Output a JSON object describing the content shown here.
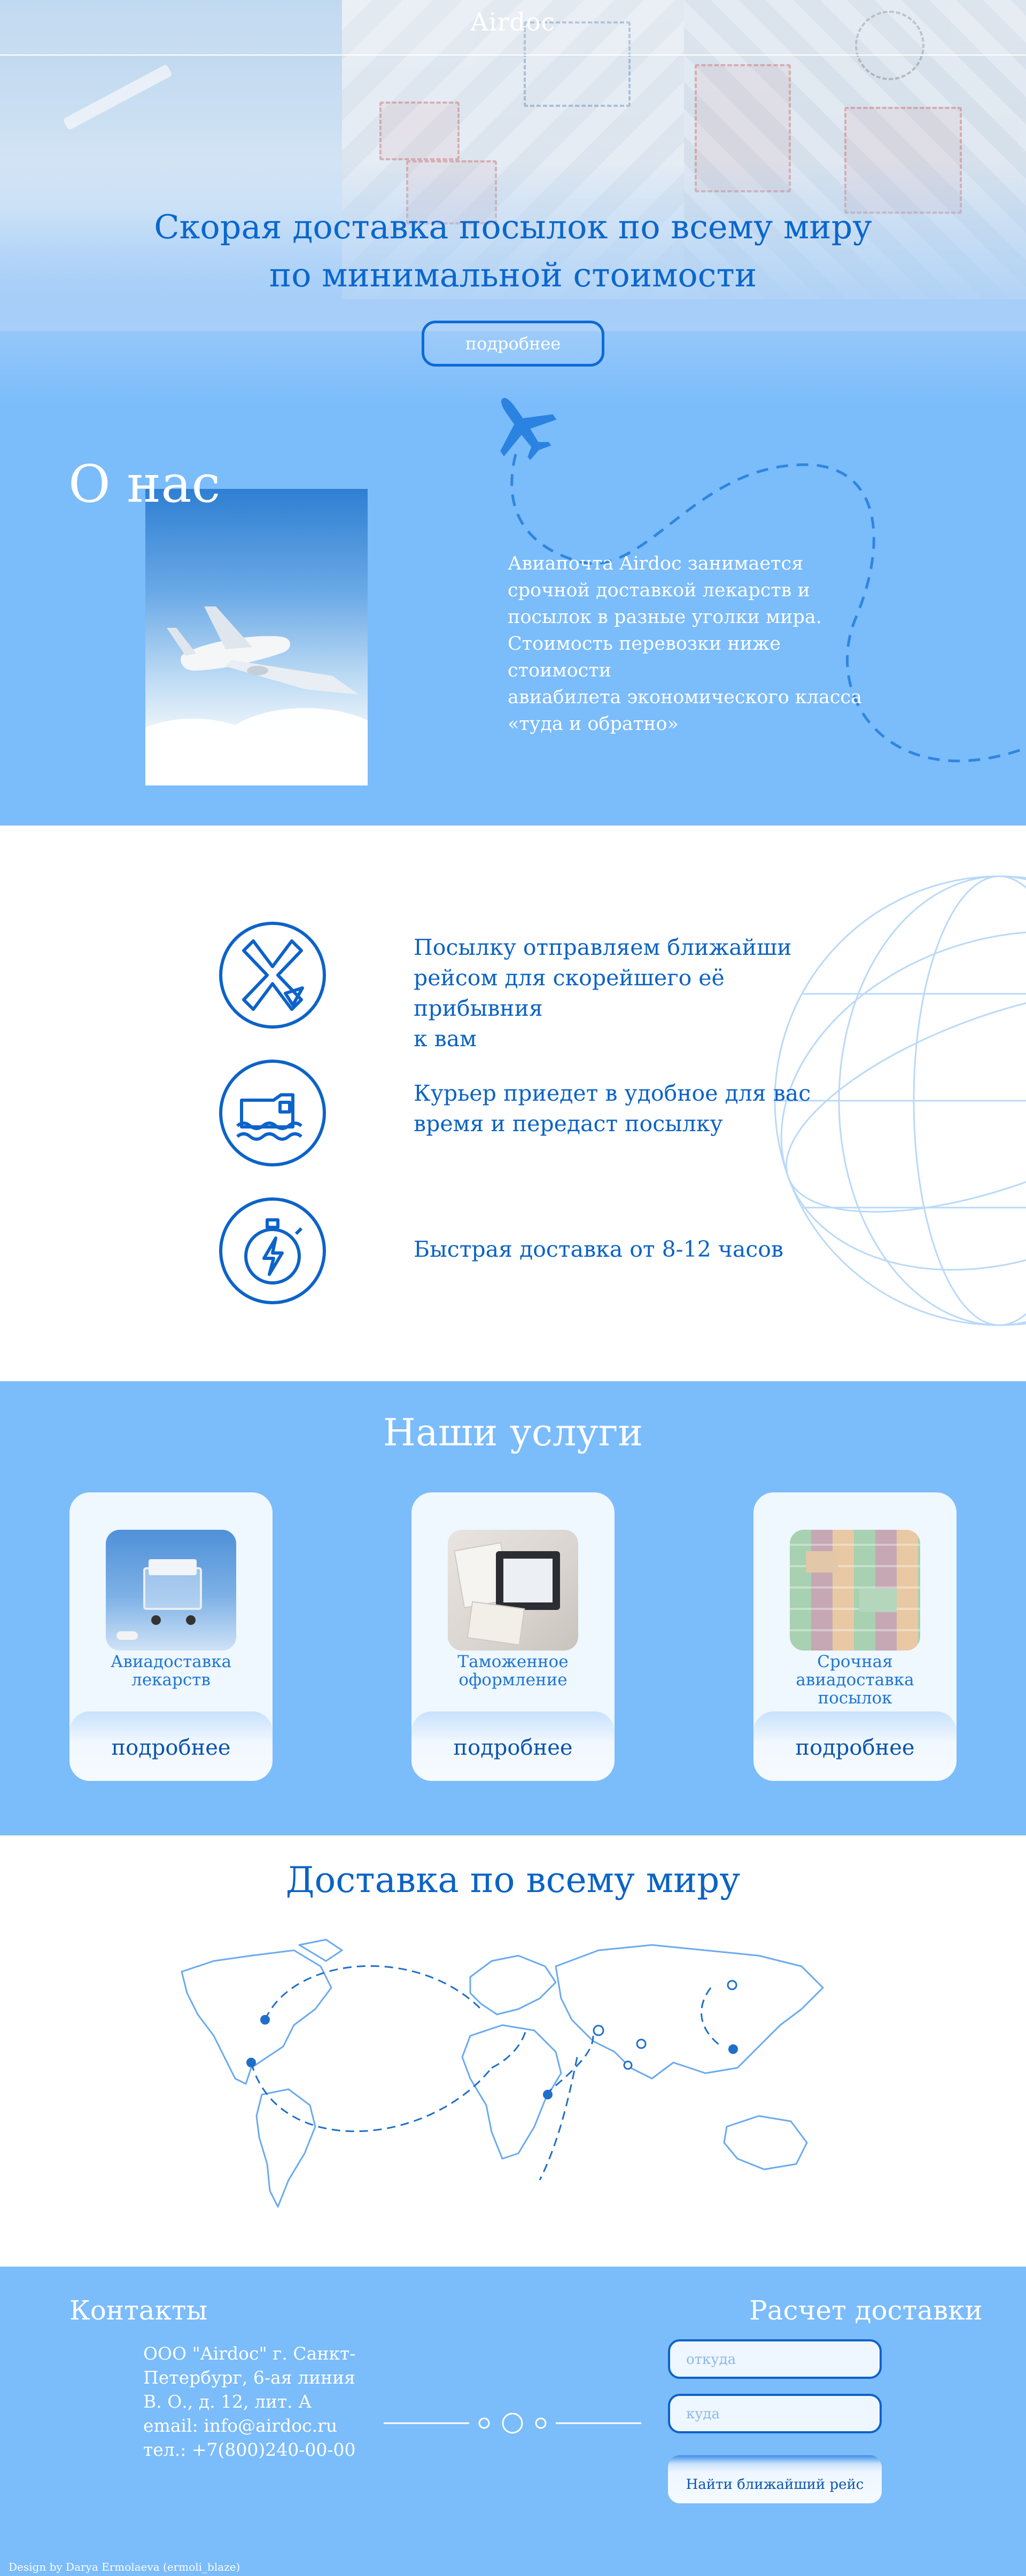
{
  "header": {
    "brand": "Airdoc"
  },
  "hero": {
    "title_line1": "Скорая доставка посылок по всему миру",
    "title_line2": "по минимальной стоимости",
    "button_label": "подробнее"
  },
  "about": {
    "title": "О нас",
    "text_lines": [
      "Авиапочта Airdoc занимается",
      "срочной доставкой лекарств и",
      "посылок в разные уголки мира.",
      "Стоимость перевозки ниже стоимости",
      "авиабилета экономического класса",
      "«туда и обратно»"
    ]
  },
  "features": [
    {
      "icon": "airplane-cross-icon",
      "lines": [
        "Посылку отправляем ближайши",
        "рейсом для скорейшего её прибывния",
        "к вам"
      ]
    },
    {
      "icon": "delivery-truck-icon",
      "lines": [
        "Курьер приедет в удобное для вас",
        "время и передаст посылку"
      ]
    },
    {
      "icon": "stopwatch-lightning-icon",
      "lines": [
        "Быстрая доставка от 8-12 часов"
      ]
    }
  ],
  "services": {
    "title": "Наши услуги",
    "cards": [
      {
        "label_lines": [
          "Авиадоставка",
          "лекарств"
        ],
        "button": "подробнее"
      },
      {
        "label_lines": [
          "Таможенное",
          "оформление"
        ],
        "button": "подробнее"
      },
      {
        "label_lines": [
          "Срочная",
          "авиадоставка",
          "посылок"
        ],
        "button": "подробнее"
      }
    ]
  },
  "world": {
    "title": "Доставка по всему миру"
  },
  "contacts": {
    "title": "Контакты",
    "lines": [
      "ООО \"Airdoc\" г. Санкт-",
      "Петербург, 6-ая линия",
      "В. О., д. 12, лит. А",
      "email: info@airdoc.ru",
      "тел.: +7(800)240-00-00"
    ]
  },
  "calculator": {
    "title": "Расчет доставки",
    "from_placeholder": "откуда",
    "to_placeholder": "куда",
    "button": "Найти ближайший рейс"
  },
  "footer": {
    "credit": "Design by Darya Ermolaeva (ermoli_blaze)"
  },
  "colors": {
    "accent": "#0c63c9",
    "section_blue": "#7bbcfb",
    "card_bg": "#eff7ff"
  }
}
